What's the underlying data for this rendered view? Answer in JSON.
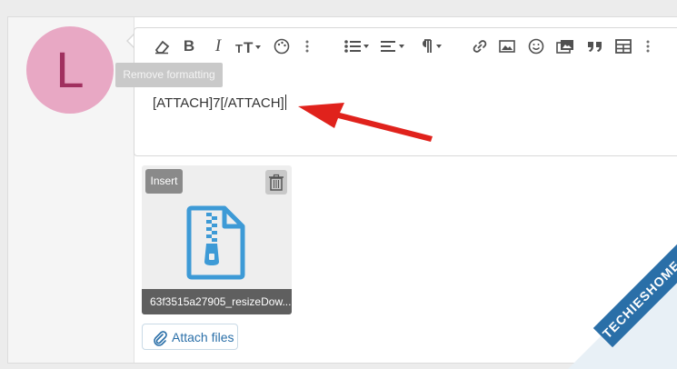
{
  "avatar": {
    "letter": "L"
  },
  "toolbar": {
    "tooltip": "Remove formatting",
    "items": [
      "remove-formatting",
      "bold",
      "italic",
      "text-size",
      "color",
      "more",
      "list",
      "align",
      "paragraph",
      "link",
      "image",
      "emoji",
      "media",
      "quote",
      "table",
      "more-right"
    ]
  },
  "editor": {
    "content": "[ATTACH]7[/ATTACH]"
  },
  "attachment": {
    "insert_label": "Insert",
    "file_name": "63f3515a27905_resizeDow..."
  },
  "attach_button": {
    "label": "Attach files"
  },
  "watermark": {
    "text": "TECHIESHOME.COM"
  },
  "colors": {
    "avatar_bg": "#e8a8c4",
    "avatar_letter": "#a0305f",
    "accent": "#2a6fa8",
    "arrow": "#e0221c"
  }
}
